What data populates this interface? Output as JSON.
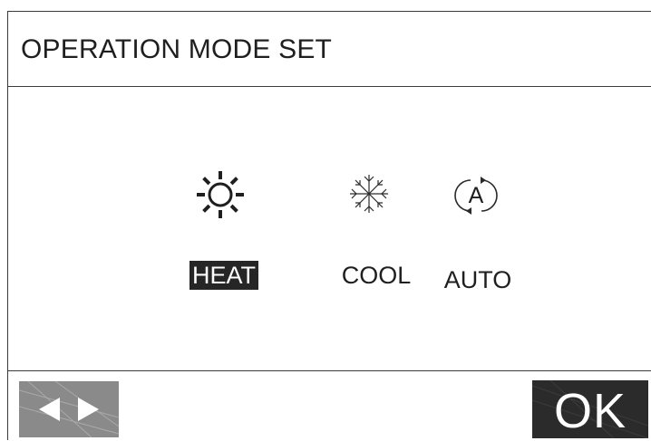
{
  "header": {
    "title": "OPERATION MODE SET"
  },
  "modes": [
    {
      "id": "heat",
      "label": "HEAT",
      "icon": "sun-icon",
      "selected": true
    },
    {
      "id": "cool",
      "label": "COOL",
      "icon": "snowflake-icon",
      "selected": false
    },
    {
      "id": "auto",
      "label": "AUTO",
      "icon": "auto-mode-icon",
      "icon_letter": "A",
      "selected": false
    }
  ],
  "footer": {
    "nav_icons": [
      "left-arrow-icon",
      "right-arrow-icon"
    ],
    "ok_label": "OK"
  },
  "colors": {
    "selected_background": "#262626",
    "nav_button": "#8a8a8a",
    "ok_button": "#2b2b2b"
  }
}
